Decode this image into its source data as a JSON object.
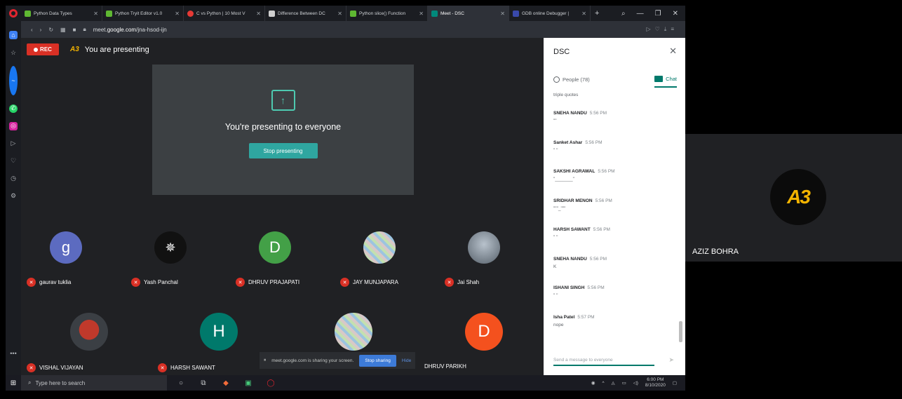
{
  "browser": {
    "tabs": [
      {
        "title": "Python Data Types",
        "fav_color": "#5fb832"
      },
      {
        "title": "Python Tryit Editor v1.0",
        "fav_color": "#5fb832"
      },
      {
        "title": "C vs Python | 10 Most V",
        "fav_color": "#e53935"
      },
      {
        "title": "Difference Between DC",
        "fav_color": "#555555"
      },
      {
        "title": "Python slice() Function",
        "fav_color": "#5fb832"
      },
      {
        "title": "Meet - DSC",
        "fav_color": "#00897b",
        "active": true
      },
      {
        "title": "GDB online Debugger |",
        "fav_color": "#3949ab"
      }
    ],
    "url_prefix": "meet.",
    "url_host": "google.com",
    "url_path": "/jna-hsod-ijn"
  },
  "meet": {
    "rec_label": "REC",
    "presenting_label": "You are presenting",
    "logo_mini": "A3",
    "present_message": "You're presenting to everyone",
    "stop_presenting": "Stop presenting",
    "participants_row1": [
      {
        "name": "gaurav tuklia",
        "initial": "g",
        "color": "#5c6bc0"
      },
      {
        "name": "Yash Panchal",
        "initial": "",
        "color": "#111111"
      },
      {
        "name": "DHRUV PRAJAPATI",
        "initial": "D",
        "color": "#43a047"
      },
      {
        "name": "JAY MUNJAPARA",
        "initial": "",
        "color": "#8e9aa6"
      },
      {
        "name": "Jai Shah",
        "initial": "",
        "color": "#7a8794"
      }
    ],
    "participants_row2": [
      {
        "name": "VISHAL VIJAYAN",
        "initial": "",
        "color": "#3b3f44"
      },
      {
        "name": "HARSH SAWANT",
        "initial": "H",
        "color": "#00796b"
      },
      {
        "name": "",
        "initial": "",
        "color": "#9aa8b6"
      },
      {
        "name": "DHRUV PARIKH",
        "initial": "D",
        "color": "#f4511e"
      }
    ],
    "share_notice": "meet.google.com is sharing your screen.",
    "stop_sharing": "Stop sharing",
    "hide": "Hide"
  },
  "chat": {
    "title": "DSC",
    "people_tab": "People (78)",
    "chat_tab": "Chat",
    "first_msg": "triple quotes",
    "messages": [
      {
        "sender": "SNEHA NANDU",
        "time": "5:56 PM",
        "text": "\"\""
      },
      {
        "sender": "Sanket Ashar",
        "time": "5:56 PM",
        "text": "\" \""
      },
      {
        "sender": "SAKSHI AGRAWAL",
        "time": "5:56 PM",
        "text": "\"_______\""
      },
      {
        "sender": "SRIDHAR MENON",
        "time": "5:56 PM",
        "text": "\"\"\"_\"\"\""
      },
      {
        "sender": "HARSH SAWANT",
        "time": "5:56 PM",
        "text": "\" \""
      },
      {
        "sender": "SNEHA NANDU",
        "time": "5:56 PM",
        "text": "K"
      },
      {
        "sender": "ISHANI SINGH",
        "time": "5:56 PM",
        "text": "\" \""
      },
      {
        "sender": "Isha Patel",
        "time": "5:57 PM",
        "text": "nope"
      }
    ],
    "input_placeholder": "Send a message to everyone"
  },
  "taskbar": {
    "search_placeholder": "Type here to search",
    "time": "6:00 PM",
    "date": "8/10/2020"
  },
  "right_tile": {
    "name": "AZIZ BOHRA",
    "logo_text": "A3"
  }
}
